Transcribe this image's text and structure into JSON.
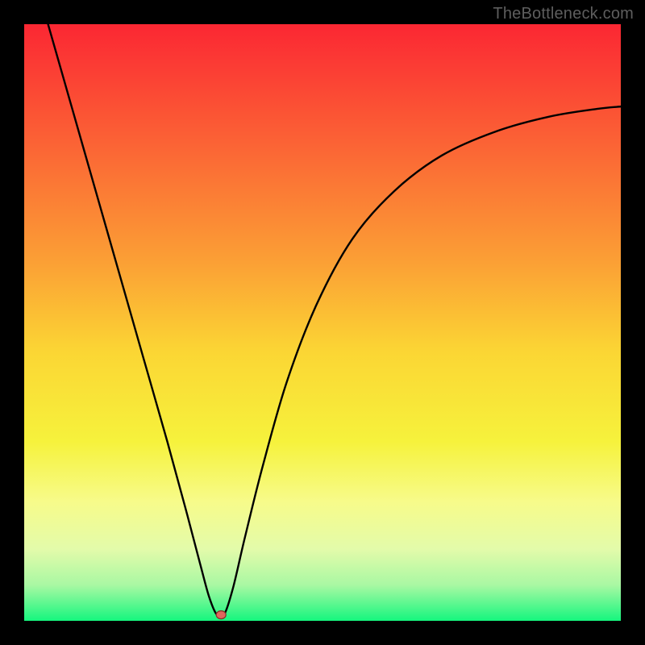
{
  "watermark": "TheBottleneck.com",
  "chart_data": {
    "type": "line",
    "title": "",
    "xlabel": "",
    "ylabel": "",
    "xlim": [
      0,
      1
    ],
    "ylim": [
      0,
      1
    ],
    "notes": "Axes unlabeled; values approximate, normalized 0–1. Background is a vertical heat gradient (red→green). One black curve with a sharp minimum and a small red marker at the minimum.",
    "gradient_stops": [
      {
        "offset": 0.0,
        "color": "#fb2733"
      },
      {
        "offset": 0.2,
        "color": "#fb6335"
      },
      {
        "offset": 0.4,
        "color": "#fba035"
      },
      {
        "offset": 0.55,
        "color": "#fbd634"
      },
      {
        "offset": 0.7,
        "color": "#f6f23c"
      },
      {
        "offset": 0.8,
        "color": "#f7fb8a"
      },
      {
        "offset": 0.88,
        "color": "#e3fbaa"
      },
      {
        "offset": 0.94,
        "color": "#a9f8a3"
      },
      {
        "offset": 1.0,
        "color": "#15f67e"
      }
    ],
    "series": [
      {
        "name": "curve",
        "x": [
          0.04,
          0.08,
          0.12,
          0.16,
          0.2,
          0.24,
          0.27,
          0.295,
          0.31,
          0.323,
          0.335,
          0.35,
          0.37,
          0.4,
          0.44,
          0.49,
          0.55,
          0.62,
          0.7,
          0.79,
          0.88,
          0.96,
          1.0
        ],
        "y": [
          1.0,
          0.86,
          0.72,
          0.58,
          0.44,
          0.3,
          0.19,
          0.095,
          0.04,
          0.01,
          0.01,
          0.055,
          0.14,
          0.26,
          0.4,
          0.53,
          0.64,
          0.72,
          0.78,
          0.82,
          0.845,
          0.858,
          0.862
        ]
      }
    ],
    "marker": {
      "x": 0.33,
      "y": 0.01,
      "fill": "#e1655d",
      "stroke": "#8a2d29"
    }
  }
}
